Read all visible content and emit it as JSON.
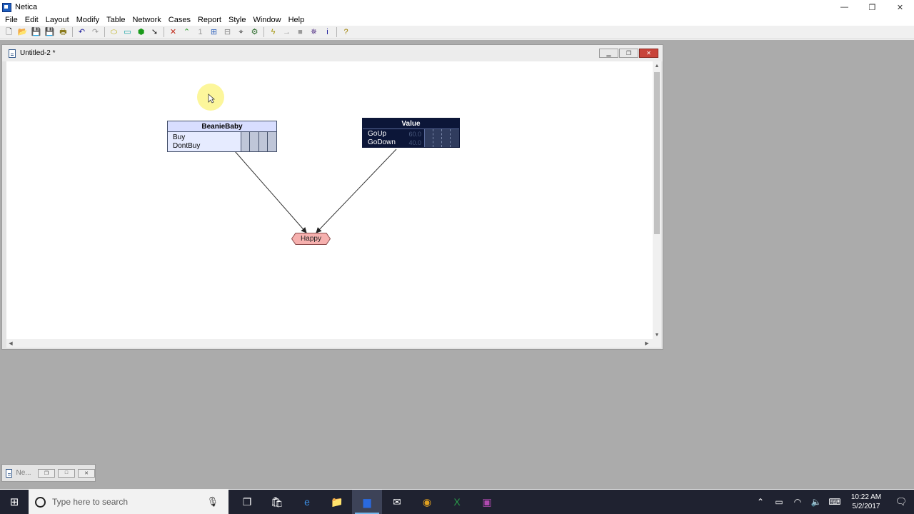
{
  "window": {
    "title": "Netica",
    "controls": {
      "minimize": "—",
      "restore": "❐",
      "close": "✕"
    }
  },
  "menu": [
    "File",
    "Edit",
    "Layout",
    "Modify",
    "Table",
    "Network",
    "Cases",
    "Report",
    "Style",
    "Window",
    "Help"
  ],
  "toolbar": {
    "buttons": [
      {
        "name": "new-icon",
        "glyph": "🗋",
        "color": "#1c1c1c"
      },
      {
        "name": "open-folder-icon",
        "glyph": "📂",
        "color": "#c89a2a"
      },
      {
        "name": "save-icon",
        "glyph": "💾",
        "color": "#1c1c1c"
      },
      {
        "name": "save-all-icon",
        "glyph": "💾",
        "color": "#8a7a1a"
      },
      {
        "name": "print-icon",
        "glyph": "🖶",
        "color": "#8a7a1a"
      },
      "|",
      {
        "name": "undo-icon",
        "glyph": "↶",
        "color": "#1c1c9c"
      },
      {
        "name": "redo-icon",
        "glyph": "↷",
        "color": "#9a9a9a"
      },
      "|",
      {
        "name": "chance-node-tool-icon",
        "glyph": "⬭",
        "color": "#b8a800"
      },
      {
        "name": "decision-node-tool-icon",
        "glyph": "▭",
        "color": "#0aa0a0"
      },
      {
        "name": "utility-node-tool-icon",
        "glyph": "⬢",
        "color": "#1a9a1a"
      },
      {
        "name": "select-arrow-tool-icon",
        "glyph": "➘",
        "color": "#1c1c1c"
      },
      "|",
      {
        "name": "delete-link-icon",
        "glyph": "✕",
        "color": "#c02a1a"
      },
      {
        "name": "add-link-icon",
        "glyph": "⌃",
        "color": "#1a9a1a"
      },
      {
        "name": "link-number-icon",
        "glyph": "1",
        "color": "#9a9a9a"
      },
      {
        "name": "add-parent-icon",
        "glyph": "⊞",
        "color": "#3a6abf"
      },
      {
        "name": "absorb-node-icon",
        "glyph": "⊟",
        "color": "#8a8a8a"
      },
      {
        "name": "sensitivity-icon",
        "glyph": "⌖",
        "color": "#3a3a3a"
      },
      {
        "name": "node-graph-icon",
        "glyph": "⚙",
        "color": "#2a6a2a"
      },
      "|",
      {
        "name": "compile-lightning-icon",
        "glyph": "ϟ",
        "color": "#a09000"
      },
      {
        "name": "right-arrow-icon",
        "glyph": "→",
        "color": "#9a9a9a"
      },
      {
        "name": "stop-square-icon",
        "glyph": "■",
        "color": "#9a9a9a"
      },
      {
        "name": "optimize-star-icon",
        "glyph": "✵",
        "color": "#5a3a8a"
      },
      {
        "name": "info-icon",
        "glyph": "i",
        "color": "#1c1c9c"
      },
      "|",
      {
        "name": "help-question-icon",
        "glyph": "?",
        "color": "#a08000"
      }
    ]
  },
  "network_window": {
    "title": "Untitled-2 *",
    "nodes": {
      "beaniebaby": {
        "title": "BeanieBaby",
        "states": [
          "Buy",
          "DontBuy"
        ]
      },
      "value": {
        "title": "Value",
        "states": [
          {
            "label": "GoUp",
            "value": "60.0"
          },
          {
            "label": "GoDown",
            "value": "40.0"
          }
        ]
      },
      "happy": {
        "title": "Happy"
      }
    }
  },
  "minimized_window": {
    "title": "Ne..."
  },
  "taskbar": {
    "search_placeholder": "Type here to search",
    "apps": [
      {
        "name": "task-view-icon",
        "glyph": "❐",
        "color": "#ffffff"
      },
      {
        "name": "store-icon",
        "glyph": "🛍",
        "color": "#ffffff"
      },
      {
        "name": "edge-browser-icon",
        "glyph": "e",
        "color": "#3c8de0"
      },
      {
        "name": "file-explorer-icon",
        "glyph": "📁",
        "color": "#f0c040"
      },
      {
        "name": "netica-app-icon",
        "glyph": "▆",
        "color": "#2a6ae0"
      },
      {
        "name": "mail-icon",
        "glyph": "✉",
        "color": "#ffffff"
      },
      {
        "name": "chrome-browser-icon",
        "glyph": "◉",
        "color": "#e0a020"
      },
      {
        "name": "excel-icon",
        "glyph": "X",
        "color": "#2a9a4a"
      },
      {
        "name": "recorder-app-icon",
        "glyph": "▣",
        "color": "#b04ab0"
      }
    ],
    "time": "10:22 AM",
    "date": "5/2/2017"
  }
}
